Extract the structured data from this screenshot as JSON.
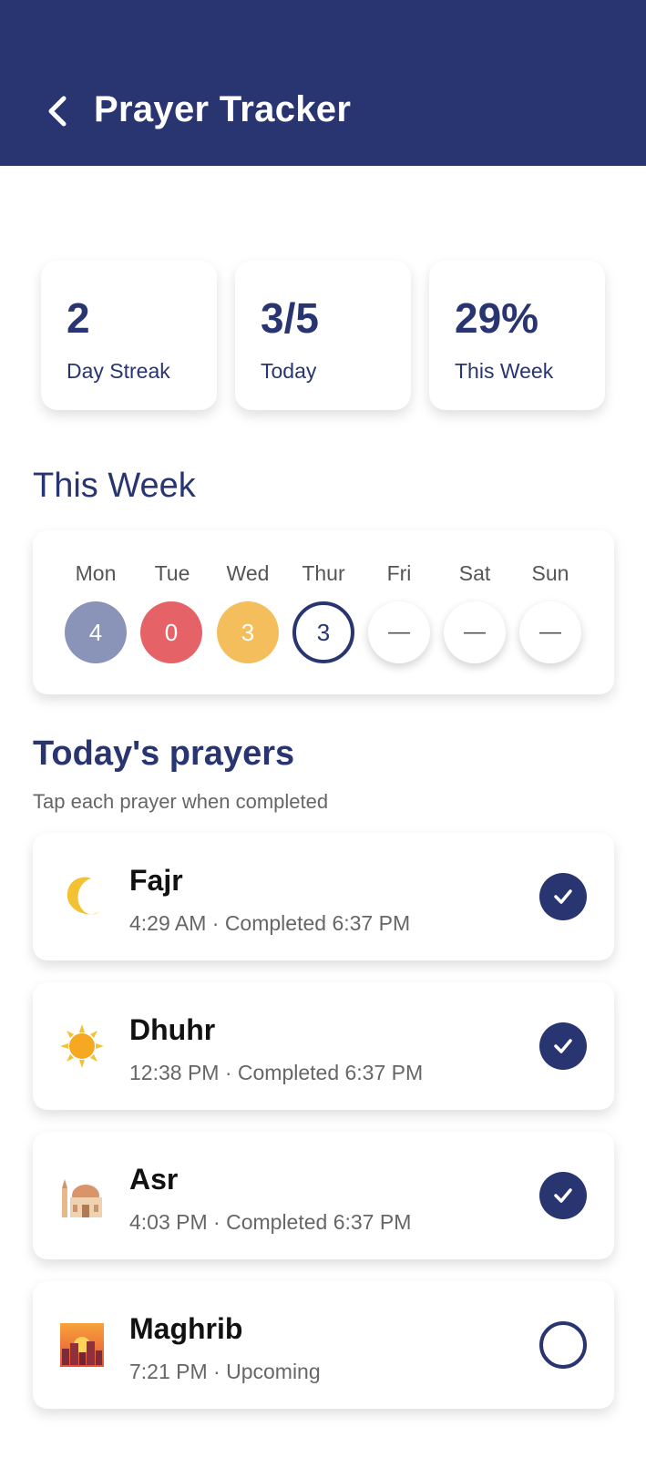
{
  "header": {
    "title": "Prayer Tracker",
    "back_icon": "chevron-left-icon"
  },
  "stats": [
    {
      "value": "2",
      "label": "Day Streak"
    },
    {
      "value": "3/5",
      "label": "Today"
    },
    {
      "value": "29%",
      "label": "This Week"
    }
  ],
  "week": {
    "heading": "This Week",
    "days": [
      {
        "label": "Mon",
        "value": "4",
        "color": "#8A94B8"
      },
      {
        "label": "Tue",
        "value": "0",
        "color": "#E56367"
      },
      {
        "label": "Wed",
        "value": "3",
        "color": "#F4BE5C"
      },
      {
        "label": "Thur",
        "value": "3",
        "state": "today"
      },
      {
        "label": "Fri",
        "value": "—"
      },
      {
        "label": "Sat",
        "value": "—"
      },
      {
        "label": "Sun",
        "value": "—"
      }
    ]
  },
  "prayers": {
    "heading": "Today's prayers",
    "subheading": "Tap each prayer when completed",
    "items": [
      {
        "name": "Fajr",
        "meta": "4:29 AM · Completed 6:37 PM",
        "icon": "crescent-moon-icon",
        "completed": true
      },
      {
        "name": "Dhuhr",
        "meta": "12:38 PM · Completed 6:37 PM",
        "icon": "sun-icon",
        "completed": true
      },
      {
        "name": "Asr",
        "meta": "4:03 PM · Completed 6:37 PM",
        "icon": "mosque-icon",
        "completed": true
      },
      {
        "name": "Maghrib",
        "meta": "7:21 PM · Upcoming",
        "icon": "sunset-city-icon",
        "completed": false
      }
    ]
  },
  "colors": {
    "primary": "#283571",
    "background": "#FFFFFF"
  }
}
